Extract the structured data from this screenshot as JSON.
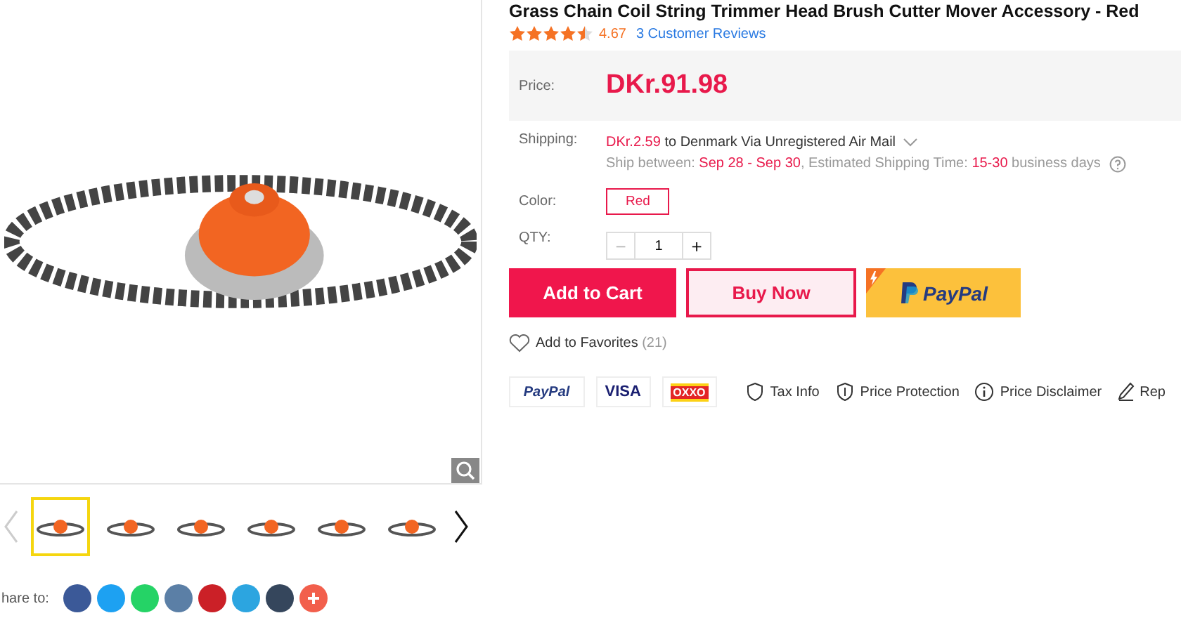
{
  "product": {
    "title": "Grass Chain Coil String Trimmer Head Brush Cutter Mover Accessory - Red",
    "stars": 4.5,
    "rating": "4.67",
    "reviews": "3 Customer Reviews"
  },
  "price": {
    "label": "Price:",
    "value": "DKr.91.98"
  },
  "shipping": {
    "label": "Shipping:",
    "cost": "DKr.2.59",
    "method": " to Denmark Via Unregistered Air Mail",
    "between_label": "Ship between: ",
    "dates": "Sep 28 - Sep 30",
    "estimate_label": ", Estimated Shipping Time: ",
    "days": "15-30",
    "days_suffix": " business days"
  },
  "color": {
    "label": "Color:",
    "options": [
      {
        "label": "Red",
        "selected": true
      }
    ]
  },
  "qty": {
    "label": "QTY:",
    "minus": "−",
    "value": "1",
    "plus": "+",
    "minus_disabled": true
  },
  "actions": [
    {
      "kind": "cart",
      "label": "Add to Cart"
    },
    {
      "kind": "buy",
      "label": "Buy Now"
    },
    {
      "kind": "paypal",
      "label": "PayPal"
    }
  ],
  "favorites": {
    "label": "Add to Favorites",
    "count": "(21)"
  },
  "payments": [
    {
      "kind": "paypal",
      "label": "PayPal"
    },
    {
      "kind": "visa",
      "label": "VISA"
    },
    {
      "kind": "oxxo",
      "label": "OXXO"
    }
  ],
  "info_links": [
    {
      "kind": "tax",
      "label": "Tax Info"
    },
    {
      "kind": "shield",
      "label": "Price Protection"
    },
    {
      "kind": "info",
      "label": "Price Disclaimer"
    },
    {
      "kind": "pen",
      "label": "Rep"
    }
  ],
  "thumbnails": [
    {
      "selected": true
    },
    {
      "selected": false
    },
    {
      "selected": false
    },
    {
      "selected": false
    },
    {
      "selected": false
    },
    {
      "selected": false
    }
  ],
  "share": {
    "label": "hare to:",
    "networks": [
      {
        "kind": "facebook",
        "color": "#3b5998"
      },
      {
        "kind": "twitter",
        "color": "#1da1f2"
      },
      {
        "kind": "whatsapp",
        "color": "#25d366"
      },
      {
        "kind": "vk",
        "color": "#5b7fa6"
      },
      {
        "kind": "pinterest",
        "color": "#cb2027"
      },
      {
        "kind": "telegram",
        "color": "#2ca5e0"
      },
      {
        "kind": "tumblr",
        "color": "#35465c"
      },
      {
        "kind": "more",
        "color": "#f25f4c"
      }
    ]
  }
}
